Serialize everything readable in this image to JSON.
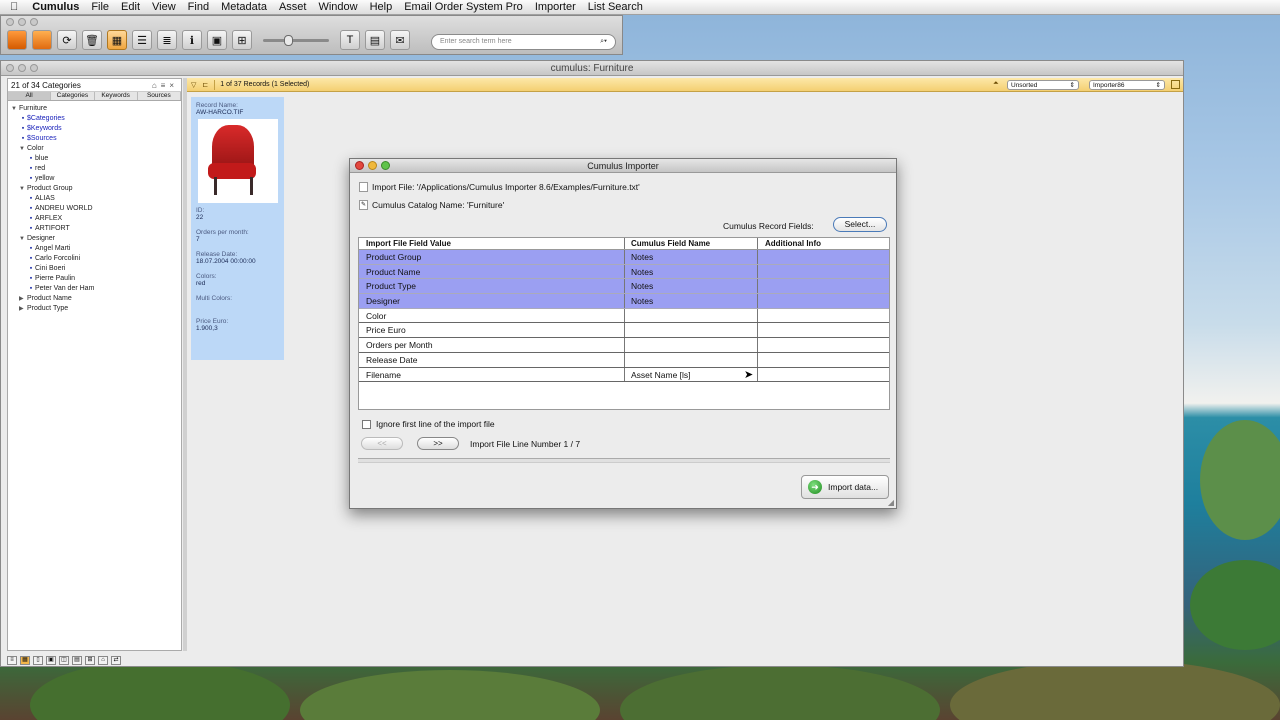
{
  "menubar": {
    "apple": "",
    "items": [
      "Cumulus",
      "File",
      "Edit",
      "View",
      "Find",
      "Metadata",
      "Asset",
      "Window",
      "Help",
      "Email Order System Pro",
      "Importer",
      "List Search"
    ]
  },
  "toolbar": {
    "search_placeholder": "Enter search term here"
  },
  "main_window": {
    "title": "cumulus: Furniture",
    "categories_count": "21 of 34 Categories",
    "tabs": [
      "All",
      "Categories",
      "Keywords",
      "Sources"
    ],
    "tree": [
      {
        "label": "Furniture",
        "level": 0,
        "type": "open"
      },
      {
        "label": "$Categories",
        "level": 1,
        "type": "link"
      },
      {
        "label": "$Keywords",
        "level": 1,
        "type": "link"
      },
      {
        "label": "$Sources",
        "level": 1,
        "type": "link"
      },
      {
        "label": "Color",
        "level": 1,
        "type": "open"
      },
      {
        "label": "blue",
        "level": 2,
        "type": "leaf"
      },
      {
        "label": "red",
        "level": 2,
        "type": "leaf"
      },
      {
        "label": "yellow",
        "level": 2,
        "type": "leaf"
      },
      {
        "label": "Product Group",
        "level": 1,
        "type": "open"
      },
      {
        "label": "ALIAS",
        "level": 2,
        "type": "leaf"
      },
      {
        "label": "ANDREU WORLD",
        "level": 2,
        "type": "leaf"
      },
      {
        "label": "ARFLEX",
        "level": 2,
        "type": "leaf"
      },
      {
        "label": "ARTIFORT",
        "level": 2,
        "type": "leaf"
      },
      {
        "label": "Designer",
        "level": 1,
        "type": "open"
      },
      {
        "label": "Angel Marti",
        "level": 2,
        "type": "leaf"
      },
      {
        "label": "Carlo Forcolini",
        "level": 2,
        "type": "leaf"
      },
      {
        "label": "Cini Boeri",
        "level": 2,
        "type": "leaf"
      },
      {
        "label": "Pierre Paulin",
        "level": 2,
        "type": "leaf"
      },
      {
        "label": "Peter Van der Ham",
        "level": 2,
        "type": "leaf"
      },
      {
        "label": "Product Name",
        "level": 1,
        "type": "closed"
      },
      {
        "label": "Product Type",
        "level": 1,
        "type": "closed"
      }
    ],
    "records_status": "1 of 37 Records (1 Selected)",
    "sort_select": "Unsorted",
    "importer_select": "Importer86",
    "record_card": {
      "name_label": "Record Name:",
      "name": "AW-HARCO.TIF",
      "id_label": "ID:",
      "id": "22",
      "orders_label": "Orders per month:",
      "orders": "7",
      "release_label": "Release Date:",
      "release": "18.07.2004 00:00:00",
      "colors_label": "Colors:",
      "colors": "red",
      "multi_label": "Multi Colors:",
      "price_label": "Price Euro:",
      "price": "1.900,3"
    }
  },
  "dialog": {
    "title": "Cumulus Importer",
    "import_file": "Import File: '/Applications/Cumulus Importer 8.6/Examples/Furniture.txt'",
    "catalog_name": "Cumulus Catalog Name: 'Furniture'",
    "record_fields_label": "Cumulus Record Fields:",
    "select_button": "Select...",
    "columns": [
      "Import File Field Value",
      "Cumulus Field Name",
      "Additional Info"
    ],
    "rows": [
      {
        "value": "Product Group",
        "field": "Notes",
        "info": "",
        "selected": true
      },
      {
        "value": "Product Name",
        "field": "Notes",
        "info": "",
        "selected": true
      },
      {
        "value": "Product Type",
        "field": "Notes",
        "info": "",
        "selected": true
      },
      {
        "value": "Designer",
        "field": "Notes",
        "info": "",
        "selected": true
      },
      {
        "value": "Color",
        "field": "",
        "info": "",
        "selected": false
      },
      {
        "value": "Price Euro",
        "field": "",
        "info": "",
        "selected": false
      },
      {
        "value": "Orders per Month",
        "field": "",
        "info": "",
        "selected": false
      },
      {
        "value": "Release Date",
        "field": "",
        "info": "",
        "selected": false
      },
      {
        "value": "Filename",
        "field": "Asset Name [ls]",
        "info": "",
        "selected": false
      }
    ],
    "ignore_first_line": "Ignore first line of the import file",
    "prev_button": "<<",
    "next_button": ">>",
    "line_number": "Import File Line Number 1 / 7",
    "import_button": "Import data..."
  },
  "colors": {
    "selected_row": "#9b9ff2",
    "record_card": "#bcd8f7",
    "toolstrip": "#f4cf72"
  }
}
